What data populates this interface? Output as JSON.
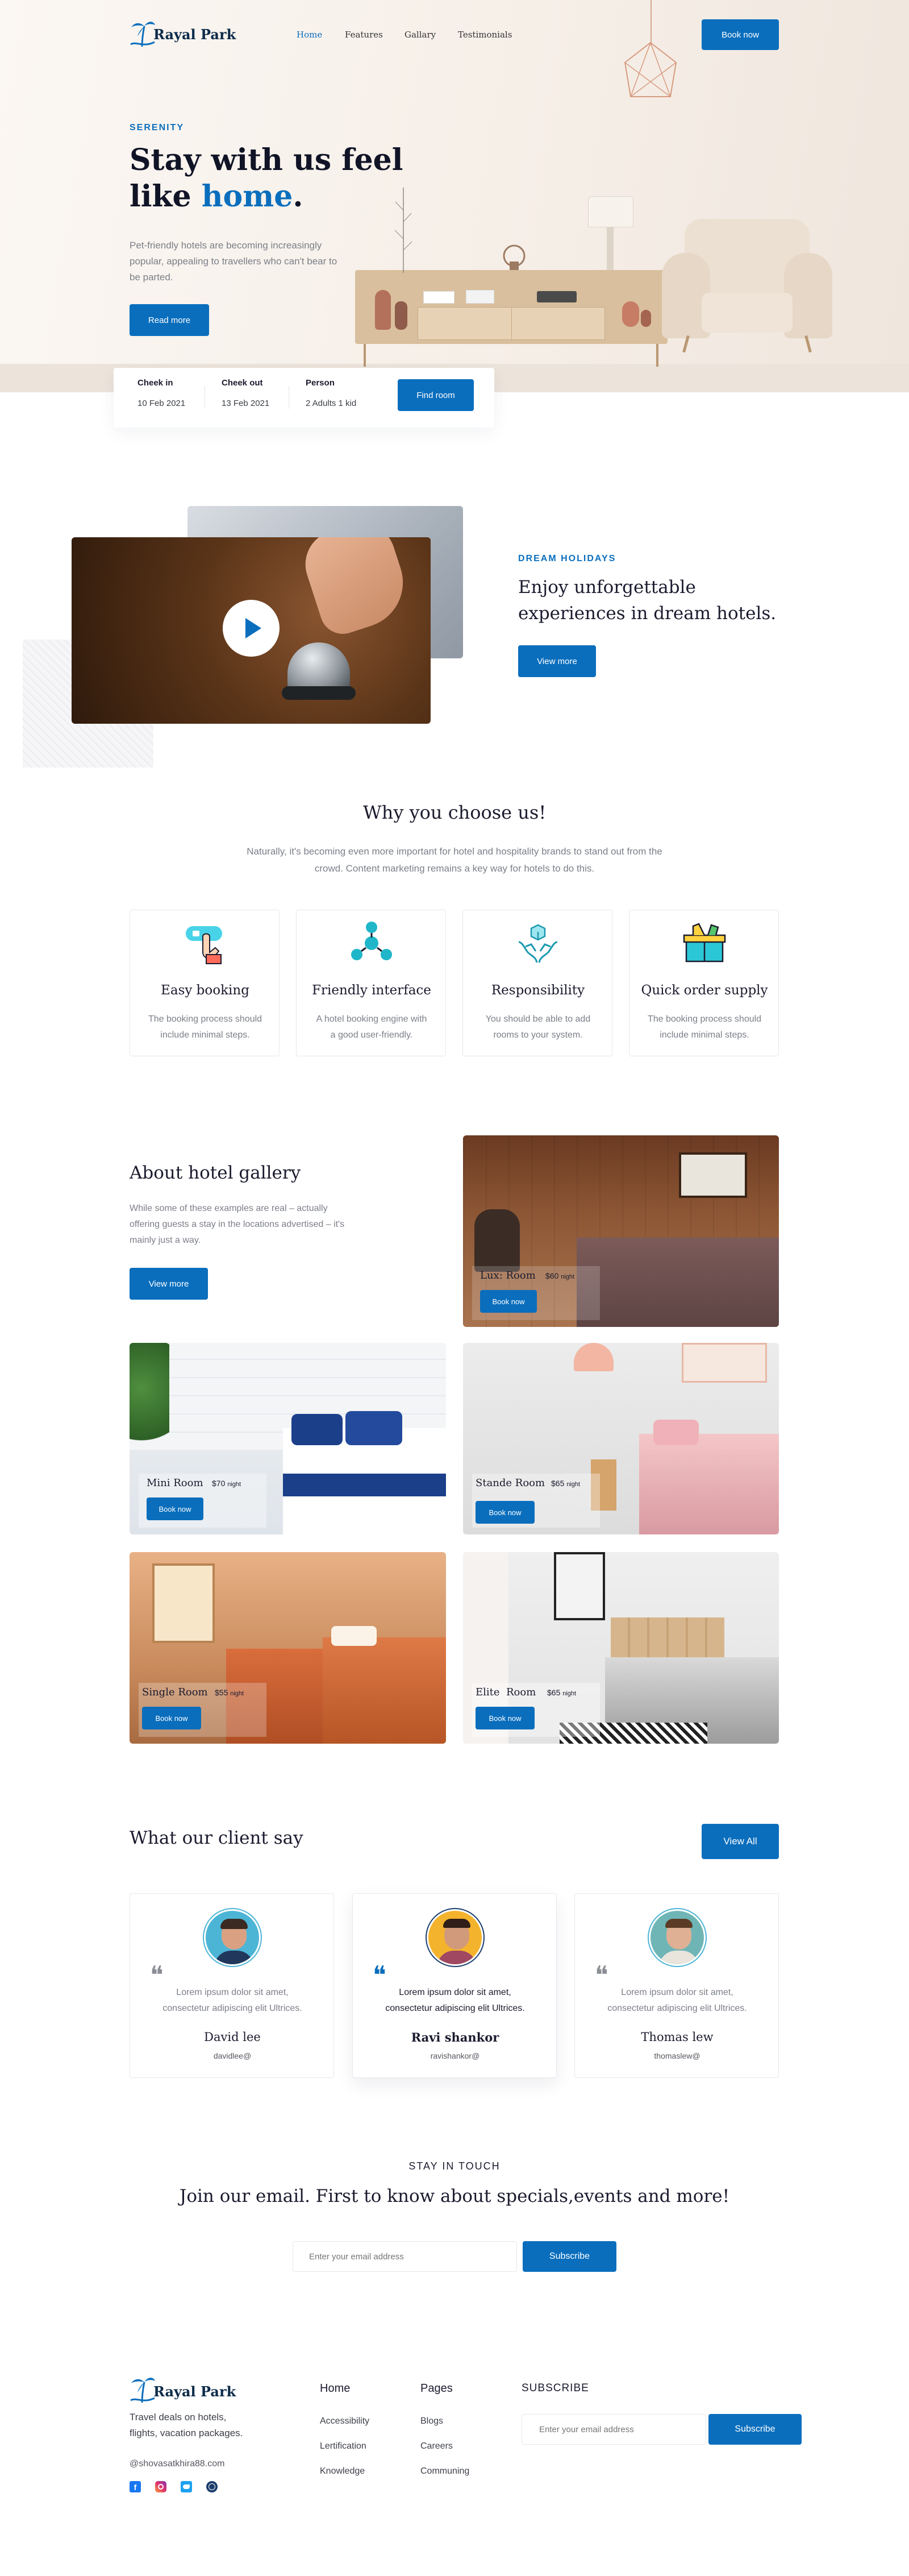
{
  "brand": {
    "name": "Rayal Park"
  },
  "nav": {
    "links": [
      "Home",
      "Features",
      "Gallary",
      "Testimonials"
    ],
    "book_now": "Book now"
  },
  "hero": {
    "eyebrow": "SERENITY",
    "title_line1": "Stay with us feel",
    "title_line2_plain": "like ",
    "title_line2_accent": "home",
    "title_line2_end": ".",
    "description": "Pet-friendly hotels are becoming increasingly popular, appealing to travellers who can't bear to be parted.",
    "cta": "Read more"
  },
  "booking": {
    "checkin_label": "Cheek in",
    "checkin_value": "10 Feb 2021",
    "checkout_label": "Cheek out",
    "checkout_value": "13 Feb 2021",
    "person_label": "Person",
    "person_value": "2 Adults 1 kid",
    "button": "Find room"
  },
  "dream": {
    "eyebrow": "DREAM HOLIDAYS",
    "title_line1": "Enjoy unforgettable",
    "title_line2": "experiences in dream hotels.",
    "cta": "View more"
  },
  "why": {
    "title": "Why you choose us!",
    "description_line1": "Naturally, it's becoming even more important for hotel and hospitality brands to stand out from the",
    "description_line2": "crowd. Content marketing remains a key way for hotels to do this.",
    "features": [
      {
        "icon": "booking-icon",
        "title": "Easy booking",
        "line1": "The booking process should",
        "line2": "include minimal steps."
      },
      {
        "icon": "interface-icon",
        "title": "Friendly interface",
        "line1": "A hotel booking engine with",
        "line2": "a good user-friendly."
      },
      {
        "icon": "responsibility-icon",
        "title": "Responsibility",
        "line1": "You should be able to add",
        "line2": "rooms to your system."
      },
      {
        "icon": "supply-icon",
        "title": "Quick order supply",
        "line1": "The booking process should",
        "line2": "include minimal steps."
      }
    ]
  },
  "gallery": {
    "title": "About hotel gallery",
    "description_line1": "While some of these examples are real – actually",
    "description_line2": "offering guests a stay in the locations advertised – it's",
    "description_line3": "mainly just a way.",
    "cta": "View more",
    "rooms": [
      {
        "name": "Lux: Room",
        "price": "$60",
        "unit": "night",
        "button": "Book now"
      },
      {
        "name": "Mini Room",
        "price": "$70",
        "unit": "night",
        "button": "Book now"
      },
      {
        "name": "Stande Room",
        "price": "$65",
        "unit": "night",
        "button": "Book now"
      },
      {
        "name": "Single Room",
        "price": "$55",
        "unit": "night",
        "button": "Book now"
      },
      {
        "name": "Elite  Room",
        "price": "$65",
        "unit": "night",
        "button": "Book now"
      }
    ]
  },
  "testimonials": {
    "title": "What our client say",
    "view_all": "View All",
    "items": [
      {
        "quote_line1": "Lorem ipsum dolor sit amet,",
        "quote_line2": "consectetur adipiscing elit Ultrices.",
        "name": "David lee",
        "handle": "davidlee@"
      },
      {
        "quote_line1": "Lorem ipsum dolor sit amet,",
        "quote_line2": "consectetur adipiscing elit Ultrices.",
        "name": "Ravi shankor",
        "handle": "ravishankor@"
      },
      {
        "quote_line1": "Lorem ipsum dolor sit amet,",
        "quote_line2": "consectetur adipiscing elit Ultrices.",
        "name": "Thomas lew",
        "handle": "thomaslew@"
      }
    ]
  },
  "newsletter": {
    "eyebrow": "STAY IN TOUCH",
    "title": "Join our email. First to know about specials,events and more!",
    "placeholder": "Enter your email address",
    "button": "Subscribe"
  },
  "footer": {
    "brand": "Rayal Park",
    "tagline_line1": "Travel deals on hotels,",
    "tagline_line2": "flights, vacation packages.",
    "email": "@shovasatkhira88.com",
    "home_heading": "Home",
    "home_links": [
      "Accessibility",
      "Lertification",
      "Knowledge"
    ],
    "pages_heading": "Pages",
    "pages_links": [
      "Blogs",
      "Careers",
      "Communing"
    ],
    "subscribe_heading": "SUBSCRIBE",
    "placeholder": "Enter your email address",
    "button": "Subscribe",
    "social": [
      "facebook-icon",
      "instagram-icon",
      "twitter-icon",
      "dribbble-icon"
    ]
  },
  "colors": {
    "accent": "#0a6ebd",
    "heading": "#1b1b2f",
    "muted": "#7b7f88"
  }
}
